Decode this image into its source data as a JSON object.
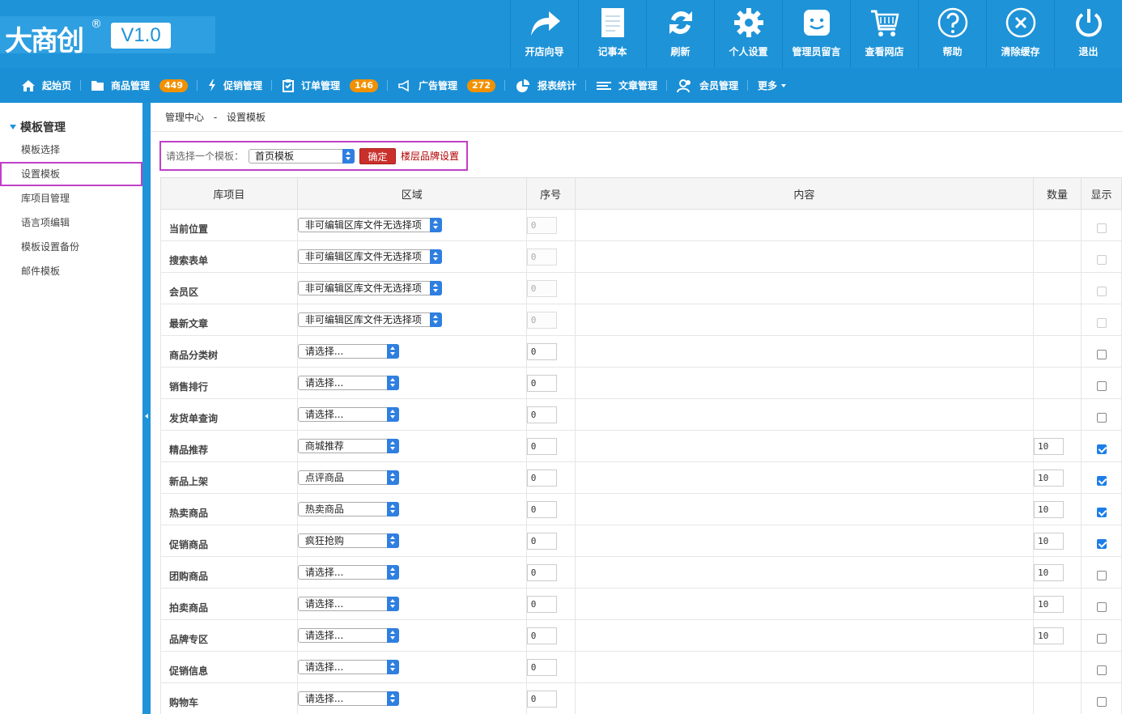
{
  "logo": {
    "text": "大商创",
    "reg": "®",
    "version": "V1.0"
  },
  "toolbar": [
    {
      "label": "开店向导",
      "icon": "share-arrow-icon"
    },
    {
      "label": "记事本",
      "icon": "notepad-icon"
    },
    {
      "label": "刷新",
      "icon": "refresh-icon"
    },
    {
      "label": "个人设置",
      "icon": "gear-icon"
    },
    {
      "label": "管理员留言",
      "icon": "message-icon"
    },
    {
      "label": "查看网店",
      "icon": "cart-icon"
    },
    {
      "label": "帮助",
      "icon": "help-icon"
    },
    {
      "label": "清除缓存",
      "icon": "clear-icon"
    },
    {
      "label": "退出",
      "icon": "power-icon"
    }
  ],
  "nav": [
    {
      "label": "起始页",
      "icon": "home-icon",
      "badge": null
    },
    {
      "label": "商品管理",
      "icon": "folder-icon",
      "badge": "449"
    },
    {
      "label": "促销管理",
      "icon": "lightning-icon",
      "badge": null
    },
    {
      "label": "订单管理",
      "icon": "clipboard-icon",
      "badge": "146"
    },
    {
      "label": "广告管理",
      "icon": "megaphone-icon",
      "badge": "272"
    },
    {
      "label": "报表统计",
      "icon": "pie-chart-icon",
      "badge": null
    },
    {
      "label": "文章管理",
      "icon": "list-icon",
      "badge": null
    },
    {
      "label": "会员管理",
      "icon": "users-icon",
      "badge": null
    },
    {
      "label": "更多",
      "icon": null,
      "badge": null
    }
  ],
  "sidebar": {
    "title": "模板管理",
    "items": [
      "模板选择",
      "设置模板",
      "库项目管理",
      "语言项编辑",
      "模板设置备份",
      "邮件模板"
    ],
    "active_index": 1
  },
  "breadcrumb": {
    "root": "管理中心",
    "sep": "-",
    "current": "设置模板"
  },
  "selector": {
    "label": "请选择一个模板：",
    "value": "首页模板",
    "ok": "确定",
    "link": "楼层品牌设置"
  },
  "table": {
    "headers": [
      "库项目",
      "区域",
      "序号",
      "内容",
      "数量",
      "显示"
    ],
    "rows": [
      {
        "name": "当前位置",
        "area": "非可编辑区库文件无选择项",
        "wide": true,
        "order": "0",
        "order_disabled": true,
        "qty": "",
        "show": false,
        "show_disabled": true
      },
      {
        "name": "搜索表单",
        "area": "非可编辑区库文件无选择项",
        "wide": true,
        "order": "0",
        "order_disabled": true,
        "qty": "",
        "show": false,
        "show_disabled": true
      },
      {
        "name": "会员区",
        "area": "非可编辑区库文件无选择项",
        "wide": true,
        "order": "0",
        "order_disabled": true,
        "qty": "",
        "show": false,
        "show_disabled": true
      },
      {
        "name": "最新文章",
        "area": "非可编辑区库文件无选择项",
        "wide": true,
        "order": "0",
        "order_disabled": true,
        "qty": "",
        "show": false,
        "show_disabled": true
      },
      {
        "name": "商品分类树",
        "area": "请选择...",
        "wide": false,
        "order": "0",
        "order_disabled": false,
        "qty": "",
        "show": false,
        "show_disabled": false
      },
      {
        "name": "销售排行",
        "area": "请选择...",
        "wide": false,
        "order": "0",
        "order_disabled": false,
        "qty": "",
        "show": false,
        "show_disabled": false
      },
      {
        "name": "发货单查询",
        "area": "请选择...",
        "wide": false,
        "order": "0",
        "order_disabled": false,
        "qty": "",
        "show": false,
        "show_disabled": false
      },
      {
        "name": "精品推荐",
        "area": "商城推荐",
        "wide": false,
        "order": "0",
        "order_disabled": false,
        "qty": "10",
        "show": true,
        "show_disabled": false
      },
      {
        "name": "新品上架",
        "area": "点评商品",
        "wide": false,
        "order": "0",
        "order_disabled": false,
        "qty": "10",
        "show": true,
        "show_disabled": false
      },
      {
        "name": "热卖商品",
        "area": "热卖商品",
        "wide": false,
        "order": "0",
        "order_disabled": false,
        "qty": "10",
        "show": true,
        "show_disabled": false
      },
      {
        "name": "促销商品",
        "area": "疯狂抢购",
        "wide": false,
        "order": "0",
        "order_disabled": false,
        "qty": "10",
        "show": true,
        "show_disabled": false
      },
      {
        "name": "团购商品",
        "area": "请选择...",
        "wide": false,
        "order": "0",
        "order_disabled": false,
        "qty": "10",
        "show": false,
        "show_disabled": false
      },
      {
        "name": "拍卖商品",
        "area": "请选择...",
        "wide": false,
        "order": "0",
        "order_disabled": false,
        "qty": "10",
        "show": false,
        "show_disabled": false
      },
      {
        "name": "品牌专区",
        "area": "请选择...",
        "wide": false,
        "order": "0",
        "order_disabled": false,
        "qty": "10",
        "show": false,
        "show_disabled": false
      },
      {
        "name": "促销信息",
        "area": "请选择...",
        "wide": false,
        "order": "0",
        "order_disabled": false,
        "qty": "",
        "show": false,
        "show_disabled": false
      },
      {
        "name": "购物车",
        "area": "请选择...",
        "wide": false,
        "order": "0",
        "order_disabled": false,
        "qty": "",
        "show": false,
        "show_disabled": false
      }
    ]
  },
  "colors": {
    "header": "#1e93d8",
    "nav": "#1a8fd6",
    "badge": "#f29100",
    "highlight": "#c040c8",
    "ok_button": "#c9302c"
  }
}
